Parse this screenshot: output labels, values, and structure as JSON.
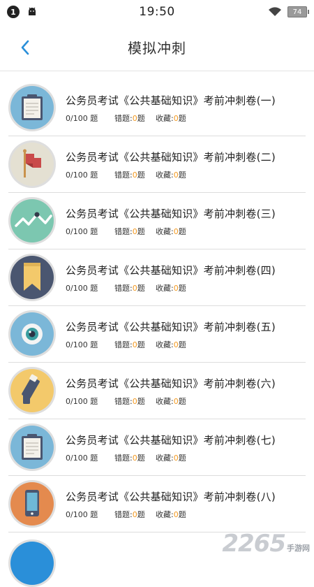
{
  "status_bar": {
    "notification_count": "1",
    "time": "19:50",
    "battery": "74"
  },
  "header": {
    "title": "模拟冲刺"
  },
  "items": [
    {
      "title": "公务员考试《公共基础知识》考前冲刺卷(一)",
      "progress": "0/100 题",
      "wrong_label": "错题:",
      "wrong_count": "0",
      "wrong_unit": "题",
      "fav_label": "收藏:",
      "fav_count": "0",
      "fav_unit": "题",
      "icon": "clipboard-icon",
      "icon_bg": "#7bb7d8"
    },
    {
      "title": "公务员考试《公共基础知识》考前冲刺卷(二)",
      "progress": "0/100 题",
      "wrong_label": "错题:",
      "wrong_count": "0",
      "wrong_unit": "题",
      "fav_label": "收藏:",
      "fav_count": "0",
      "fav_unit": "题",
      "icon": "flag-icon",
      "icon_bg": "#e4e0d2"
    },
    {
      "title": "公务员考试《公共基础知识》考前冲刺卷(三)",
      "progress": "0/100 题",
      "wrong_label": "错题:",
      "wrong_count": "0",
      "wrong_unit": "题",
      "fav_label": "收藏:",
      "fav_count": "0",
      "fav_unit": "题",
      "icon": "line-chart-icon",
      "icon_bg": "#7cc7b0"
    },
    {
      "title": "公务员考试《公共基础知识》考前冲刺卷(四)",
      "progress": "0/100 题",
      "wrong_label": "错题:",
      "wrong_count": "0",
      "wrong_unit": "题",
      "fav_label": "收藏:",
      "fav_count": "0",
      "fav_unit": "题",
      "icon": "bookmark-icon",
      "icon_bg": "#4a5670"
    },
    {
      "title": "公务员考试《公共基础知识》考前冲刺卷(五)",
      "progress": "0/100 题",
      "wrong_label": "错题:",
      "wrong_count": "0",
      "wrong_unit": "题",
      "fav_label": "收藏:",
      "fav_count": "0",
      "fav_unit": "题",
      "icon": "eye-icon",
      "icon_bg": "#7bb7d8"
    },
    {
      "title": "公务员考试《公共基础知识》考前冲刺卷(六)",
      "progress": "0/100 题",
      "wrong_label": "错题:",
      "wrong_count": "0",
      "wrong_unit": "题",
      "fav_label": "收藏:",
      "fav_count": "0",
      "fav_unit": "题",
      "icon": "telescope-icon",
      "icon_bg": "#f3c96b"
    },
    {
      "title": "公务员考试《公共基础知识》考前冲刺卷(七)",
      "progress": "0/100 题",
      "wrong_label": "错题:",
      "wrong_count": "0",
      "wrong_unit": "题",
      "fav_label": "收藏:",
      "fav_count": "0",
      "fav_unit": "题",
      "icon": "clipboard-icon",
      "icon_bg": "#7bb7d8"
    },
    {
      "title": "公务员考试《公共基础知识》考前冲刺卷(八)",
      "progress": "0/100 题",
      "wrong_label": "错题:",
      "wrong_count": "0",
      "wrong_unit": "题",
      "fav_label": "收藏:",
      "fav_count": "0",
      "fav_unit": "题",
      "icon": "phone-icon",
      "icon_bg": "#e48a4e"
    }
  ],
  "watermark": {
    "number": "2265",
    "text": "手游网"
  }
}
